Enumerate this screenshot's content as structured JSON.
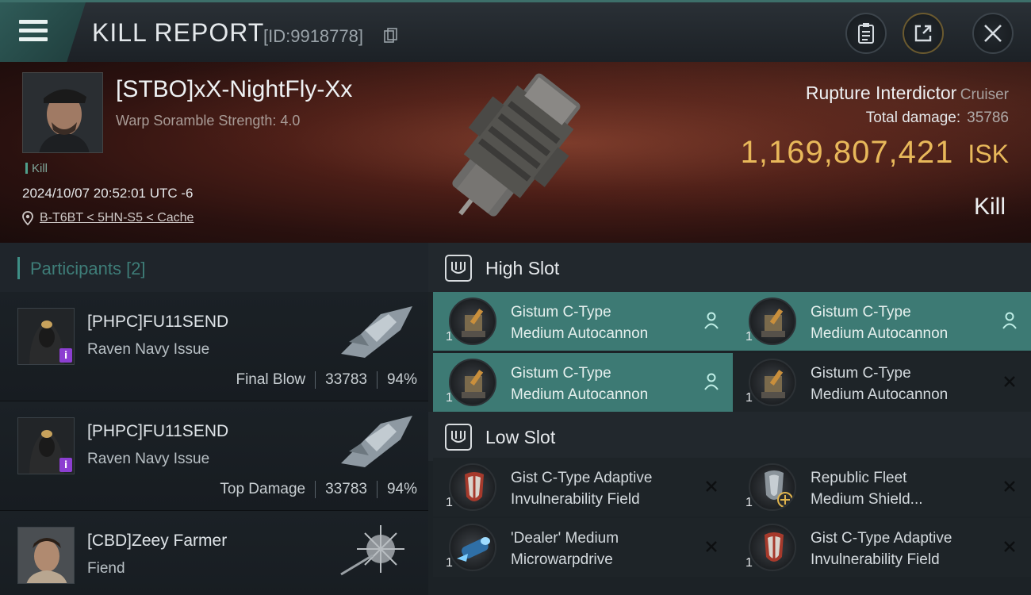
{
  "header": {
    "title": "KILL REPORT",
    "kill_id": "[ID:9918778]"
  },
  "victim": {
    "name": "[STBO]xX-NightFly-Xx",
    "warp_scramble": "Warp Soramble Strength: 4.0",
    "tag": "Kill",
    "date": "2024/10/07 20:52:01 UTC -6",
    "location": "B-T6BT < 5HN-S5 < Cache",
    "ship_name": "Rupture Interdictor",
    "ship_class": "Cruiser",
    "total_damage_label": "Total damage:",
    "total_damage_value": "35786",
    "isk_value": "1,169,807,421",
    "isk_unit": "ISK",
    "result": "Kill"
  },
  "participants": {
    "label": "Participants",
    "count": "[2]",
    "rows": [
      {
        "name": "[PHPC]FU11SEND",
        "ship": "Raven Navy Issue",
        "role": "Final Blow",
        "damage": "33783",
        "percent": "94%"
      },
      {
        "name": "[PHPC]FU11SEND",
        "ship": "Raven Navy Issue",
        "role": "Top Damage",
        "damage": "33783",
        "percent": "94%"
      },
      {
        "name": "[CBD]Zeey Farmer",
        "ship": "Fiend"
      }
    ]
  },
  "high_slot": {
    "label": "High Slot",
    "modules": [
      {
        "line1": "Gistum C-Type",
        "line2": "Medium Autocannon",
        "qty": "1",
        "state": "dropped"
      },
      {
        "line1": "Gistum C-Type",
        "line2": "Medium Autocannon",
        "qty": "1",
        "state": "dropped"
      },
      {
        "line1": "Gistum C-Type",
        "line2": "Medium Autocannon",
        "qty": "1",
        "state": "dropped"
      },
      {
        "line1": "Gistum C-Type",
        "line2": "Medium Autocannon",
        "qty": "1",
        "state": "destroyed"
      }
    ]
  },
  "low_slot": {
    "label": "Low Slot",
    "modules": [
      {
        "line1": "Gist C-Type Adaptive",
        "line2": "Invulnerability Field",
        "qty": "1",
        "state": "destroyed"
      },
      {
        "line1": "Republic Fleet",
        "line2": "Medium Shield...",
        "qty": "1",
        "state": "destroyed"
      },
      {
        "line1": "'Dealer' Medium",
        "line2": "Microwarpdrive",
        "qty": "1",
        "state": "destroyed"
      },
      {
        "line1": "Gist C-Type Adaptive",
        "line2": "Invulnerability Field",
        "qty": "1",
        "state": "destroyed"
      }
    ]
  },
  "colors": {
    "accent": "#3d7a74",
    "isk": "#e8b85a",
    "corp_badge": "#8c3fd1"
  },
  "icons": [
    "menu-icon",
    "copy-icon",
    "clipboard-icon",
    "share-icon",
    "close-icon",
    "location-pin-icon",
    "high-slot-icon",
    "low-slot-icon",
    "person-icon",
    "destroyed-x-icon"
  ]
}
